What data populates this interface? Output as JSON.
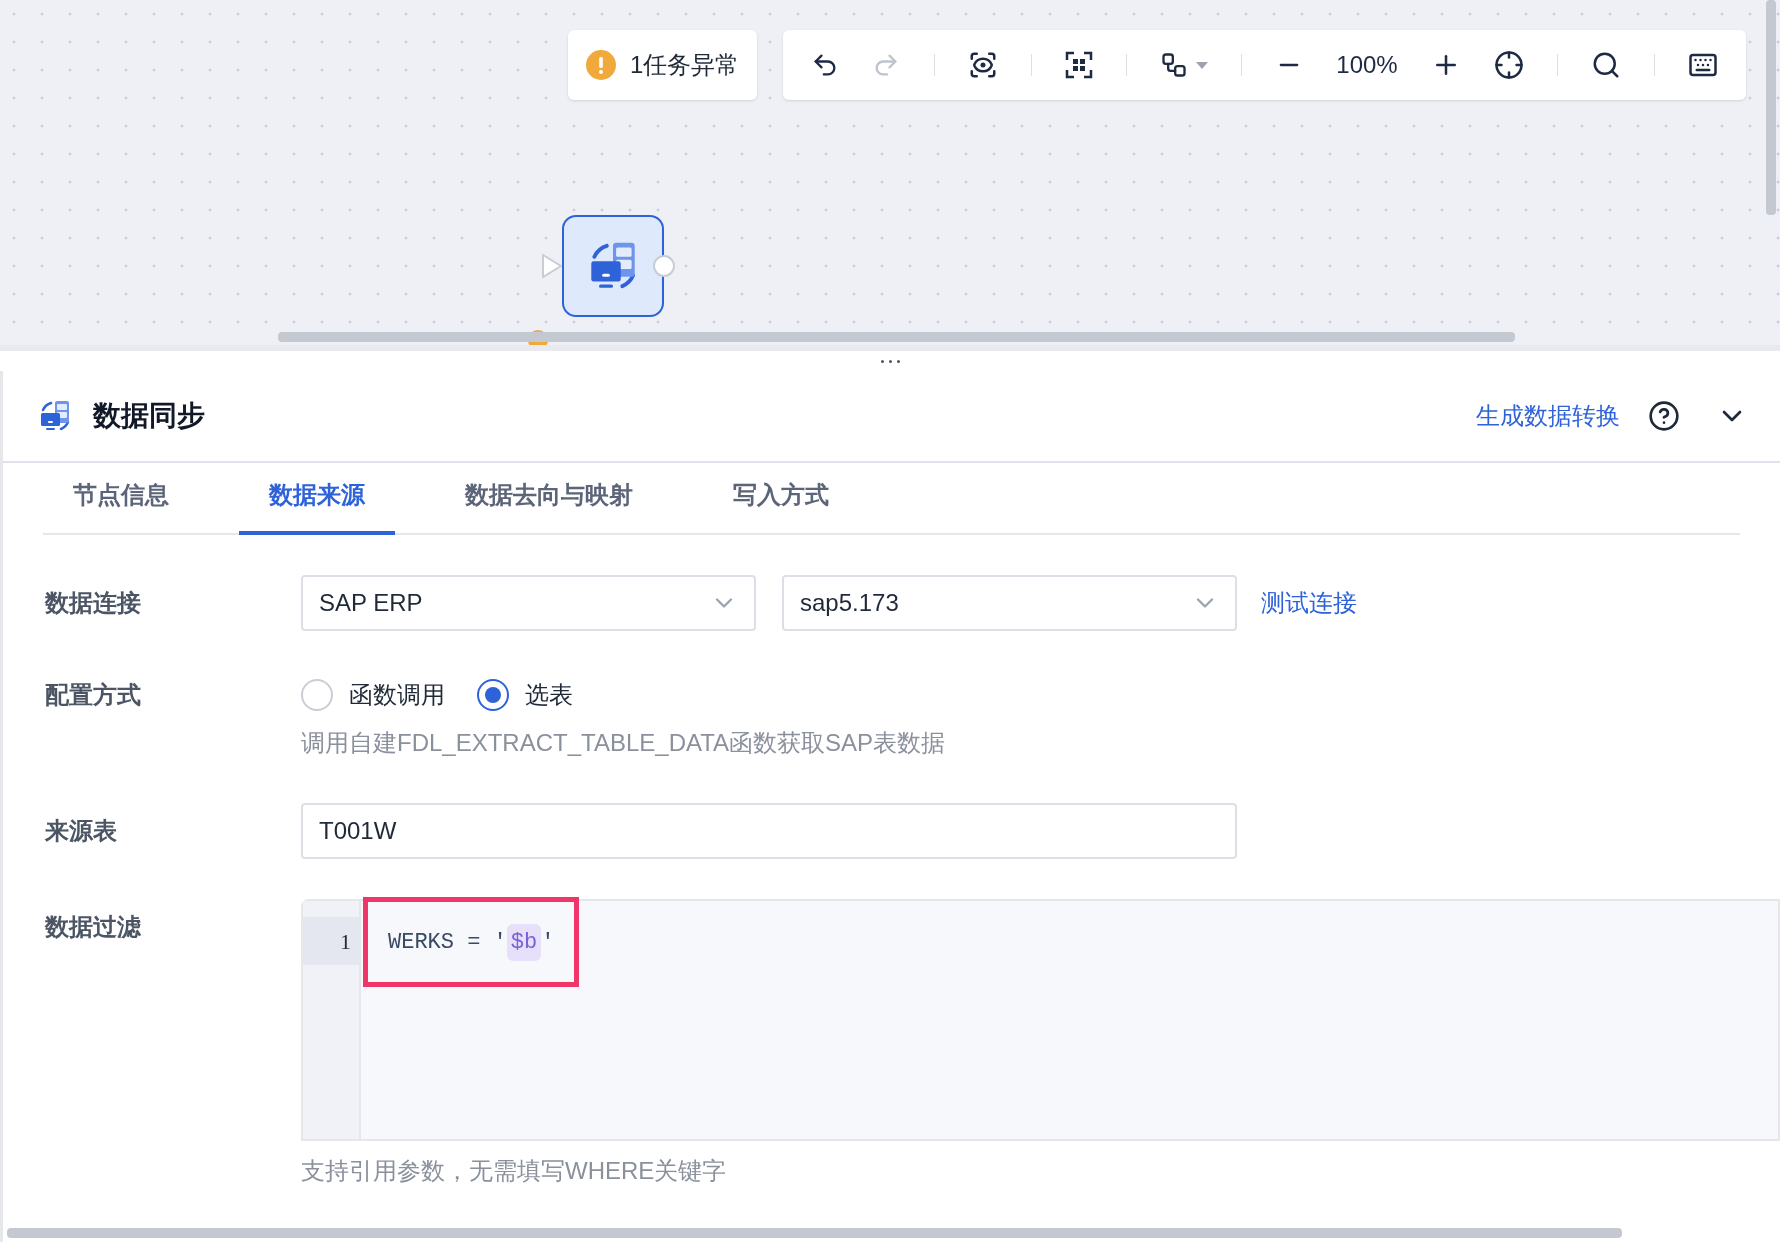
{
  "canvas": {
    "alert": {
      "count_text": "1任务异常"
    },
    "toolbar": {
      "redo_disabled": true,
      "zoom": "100%"
    },
    "node": {
      "warning": true
    }
  },
  "panel": {
    "title": "数据同步",
    "action": "生成数据转换",
    "tabs": [
      {
        "label": "节点信息",
        "selected": false
      },
      {
        "label": "数据来源",
        "selected": true
      },
      {
        "label": "数据去向与映射",
        "selected": false
      },
      {
        "label": "写入方式",
        "selected": false
      }
    ],
    "form": {
      "connection": {
        "label": "数据连接",
        "type_value": "SAP ERP",
        "conn_value": "sap5.173",
        "test": "测试连接"
      },
      "config": {
        "label": "配置方式",
        "options": [
          {
            "label": "函数调用",
            "selected": false
          },
          {
            "label": "选表",
            "selected": true
          }
        ],
        "hint": "调用自建FDL_EXTRACT_TABLE_DATA函数获取SAP表数据"
      },
      "source_table": {
        "label": "来源表",
        "value": "T001W"
      },
      "filter": {
        "label": "数据过滤",
        "line_number": "1",
        "code_before": "WERKS = '",
        "param": "$b",
        "code_after": "'",
        "highlighted": true,
        "hint": "支持引用参数，无需填写WHERE关键字"
      }
    }
  }
}
